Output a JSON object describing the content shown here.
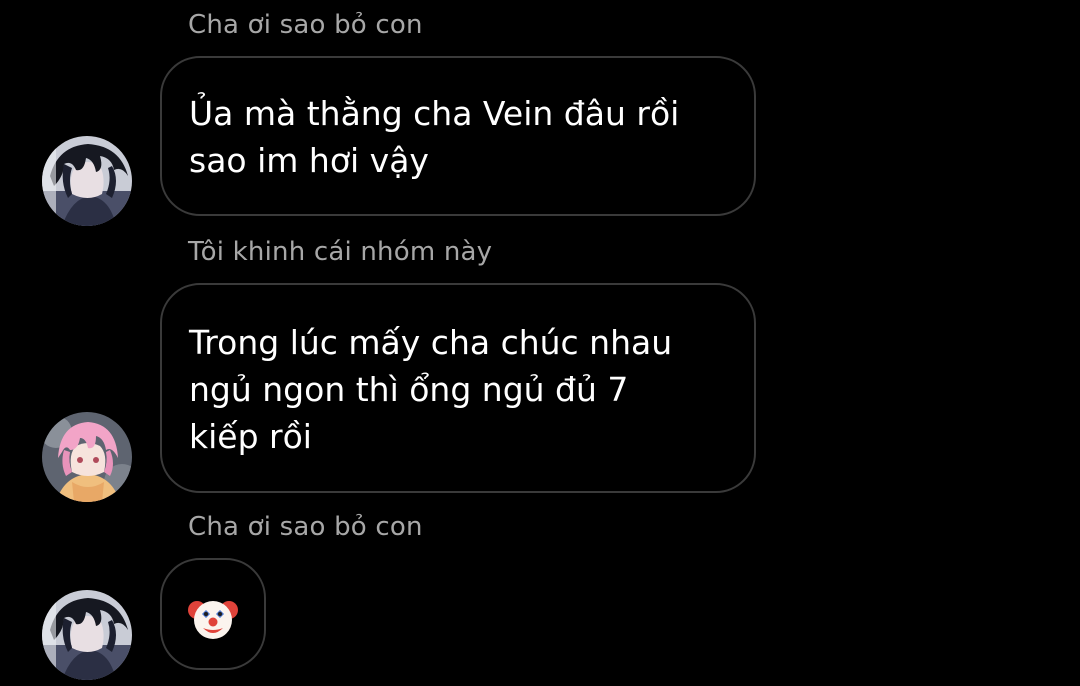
{
  "messages": [
    {
      "sender": "Cha ơi sao bỏ con",
      "text": "Ủa mà thằng cha Vein đâu rồi\nsao im hơi vậy",
      "avatar_icon": "dark-haired-anime-avatar"
    },
    {
      "sender": "Tôi khinh cái nhóm này",
      "text": "Trong lúc mấy cha chúc nhau\nngủ ngon thì ổng ngủ đủ 7\nkiếp rồi",
      "avatar_icon": "pink-haired-anime-avatar"
    },
    {
      "sender": "Cha ơi sao bỏ con",
      "emoji": "clown-face-emoji",
      "avatar_icon": "dark-haired-anime-avatar"
    }
  ],
  "colors": {
    "background": "#000000",
    "bubble_border": "#3a3a3a",
    "sender_name": "#a7a7a7",
    "message_text": "#ffffff"
  }
}
